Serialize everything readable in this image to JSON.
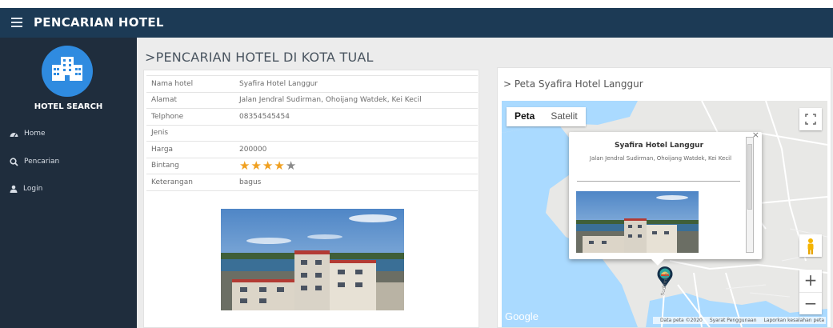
{
  "header": {
    "title": "PENCARIAN HOTEL"
  },
  "sidebar": {
    "brand": "HOTEL SEARCH",
    "items": [
      {
        "label": "Home",
        "icon": "dashboard-icon"
      },
      {
        "label": "Pencarian",
        "icon": "search-icon"
      },
      {
        "label": "Login",
        "icon": "user-icon"
      }
    ]
  },
  "page": {
    "title": ">PENCARIAN HOTEL DI KOTA TUAL"
  },
  "details": {
    "rows": [
      {
        "label": "Nama hotel",
        "value": "Syafira Hotel Langgur"
      },
      {
        "label": "Alamat",
        "value": "Jalan Jendral Sudirman, Ohoijang Watdek, Kei Kecil"
      },
      {
        "label": "Telphone",
        "value": "08354545454"
      },
      {
        "label": "Jenis",
        "value": ""
      },
      {
        "label": "Harga",
        "value": "200000"
      },
      {
        "label": "Bintang",
        "value": ""
      },
      {
        "label": "Keterangan",
        "value": "bagus"
      }
    ],
    "rating": {
      "filled": 4,
      "total": 5
    }
  },
  "map": {
    "title": "> Peta Syafira Hotel Langgur",
    "type_controls": {
      "map": "Peta",
      "satellite": "Satelit"
    },
    "zoom_in": "+",
    "zoom_out": "−",
    "popup": {
      "close": "×",
      "name": "Syafira Hotel Langgur",
      "address": "Jalan Jendral Sudirman, Ohoijang Watdek, Kei Kecil"
    },
    "logo": "Google",
    "footer": {
      "data": "Data peta ©2020",
      "terms": "Syarat Penggunaan",
      "report": "Laporkan kesalahan peta"
    },
    "street": "Sudirman"
  },
  "colors": {
    "topbar": "#1c3a55",
    "sidebar": "#1f2d3d",
    "logo": "#2f8be0",
    "star": "#f0a020"
  }
}
